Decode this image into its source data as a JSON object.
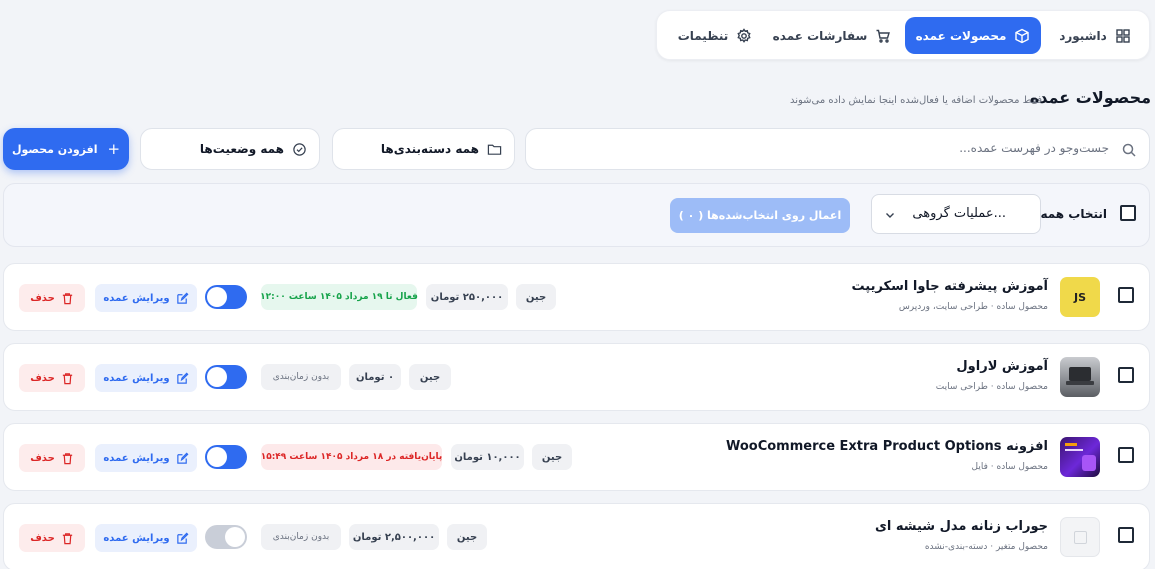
{
  "nav": {
    "items": [
      {
        "label": "داشبورد",
        "icon": "dashboard-icon"
      },
      {
        "label": "محصولات عمده",
        "icon": "box-icon",
        "active": true
      },
      {
        "label": "سفارشات عمده",
        "icon": "cart-icon"
      },
      {
        "label": "تنظیمات",
        "icon": "gear-icon"
      }
    ]
  },
  "header": {
    "title": "محصولات عمده",
    "subtitle": "فقط محصولات اضافه یا فعال‌شده اینجا نمایش داده می‌شوند"
  },
  "filters": {
    "search_placeholder": "جست‌وجو در فهرست عمده...",
    "category": "همه دسته‌بندی‌ها",
    "status": "همه وضعیت‌ها",
    "add_button": "افزودن محصول"
  },
  "bulk": {
    "select_all": "انتخاب همه",
    "action_value": "عملیات گروهی...",
    "apply_button": "اعمال روی انتخاب‌شده‌ها ( ۰ )"
  },
  "colors": {
    "accent": "#2f6bf0",
    "danger": "#dc2626",
    "success": "#16a34a"
  },
  "products": [
    {
      "name": "آموزش پیشرفته جاوا اسکریپت",
      "meta": "محصول ساده · طراحی سایت، وردپرس",
      "thumb": "JS",
      "unit": "جین",
      "price": "۲۵۰,۰۰۰ تومان",
      "schedule": "فعال تا ۱۹ مرداد ۱۴۰۵ ساعت ۱۲:۰۰",
      "schedule_type": "green",
      "enabled": true,
      "edit": "ویرایش عمده",
      "delete": "حذف"
    },
    {
      "name": "آموزش لاراول",
      "meta": "محصول ساده · طراحی سایت",
      "thumb": "",
      "unit": "جین",
      "price": "۰ تومان",
      "schedule": "بدون زمان‌بندی",
      "schedule_type": "muted",
      "enabled": true,
      "edit": "ویرایش عمده",
      "delete": "حذف"
    },
    {
      "name": "افزونه WooCommerce Extra Product Options",
      "meta": "محصول ساده · فایل",
      "thumb": "",
      "unit": "جین",
      "price": "۱۰,۰۰۰ تومان",
      "schedule": "پایان‌یافته در ۱۸ مرداد ۱۴۰۵ ساعت ۱۵:۴۹",
      "schedule_type": "red",
      "enabled": true,
      "edit": "ویرایش عمده",
      "delete": "حذف"
    },
    {
      "name": "جوراب زنانه مدل شیشه ای",
      "meta": "محصول متغیر · دسته-بندی-نشده",
      "thumb": "",
      "unit": "جین",
      "price": "۲,۵۰۰,۰۰۰ تومان",
      "schedule": "بدون زمان‌بندی",
      "schedule_type": "muted",
      "enabled": false,
      "edit": "ویرایش عمده",
      "delete": "حذف"
    }
  ]
}
